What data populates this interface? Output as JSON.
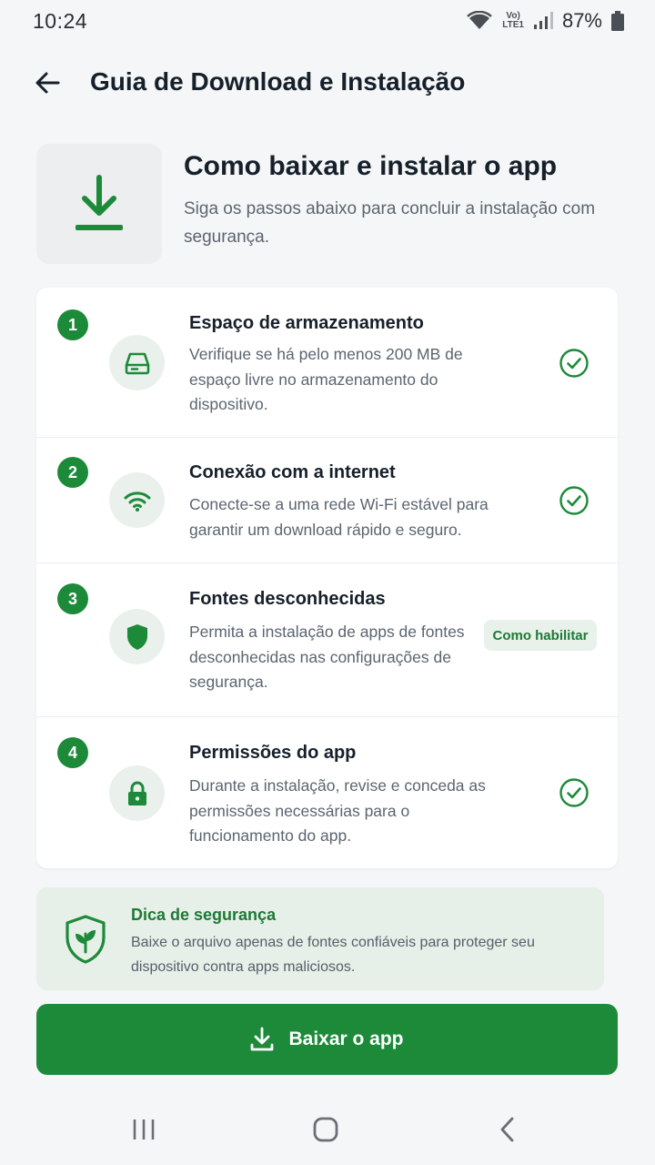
{
  "status_bar": {
    "time": "10:24",
    "network_top": "Vo)",
    "network_bottom": "LTE1",
    "battery": "87%"
  },
  "header": {
    "back_icon": "arrow-left-icon",
    "title": "Guia de Download e Instalação"
  },
  "hero": {
    "icon": "download-icon",
    "title": "Como baixar e instalar o app",
    "subtitle": "Siga os passos abaixo para concluir a instalação com segurança."
  },
  "steps": [
    {
      "number": "1",
      "icon": "storage-drive-icon",
      "title": "Espaço de armazenamento",
      "description": "Verifique se há pelo menos 200 MB de espaço livre no armazenamento do dispositivo.",
      "status": "check-circle-icon"
    },
    {
      "number": "2",
      "icon": "wifi-icon",
      "title": "Conexão com a internet",
      "description": "Conecte-se a uma rede Wi-Fi estável para garantir um download rápido e seguro.",
      "status": "check-circle-icon"
    },
    {
      "number": "3",
      "icon": "shield-icon",
      "title": "Fontes desconhecidas",
      "description": "Permita a instalação de apps de fontes desconhecidas nas configurações de segurança.",
      "action_label": "Como habilitar"
    },
    {
      "number": "4",
      "icon": "lock-icon",
      "title": "Permissões do app",
      "description": "Durante a instalação, revise e conceda as permissões necessárias para o funcionamento do app.",
      "status": "check-circle-icon"
    }
  ],
  "tip": {
    "icon": "shield-leaf-icon",
    "title": "Dica de segurança",
    "text": "Baixe o arquivo apenas de fontes confiáveis para proteger seu dispositivo contra apps maliciosos."
  },
  "download_button": {
    "icon": "download-icon",
    "label": "Baixar o app"
  },
  "colors": {
    "primary": "#1d8a3a",
    "background": "#f5f6f7",
    "icon_circle": "#eaf1ec",
    "tip_background": "#e7efe9"
  }
}
